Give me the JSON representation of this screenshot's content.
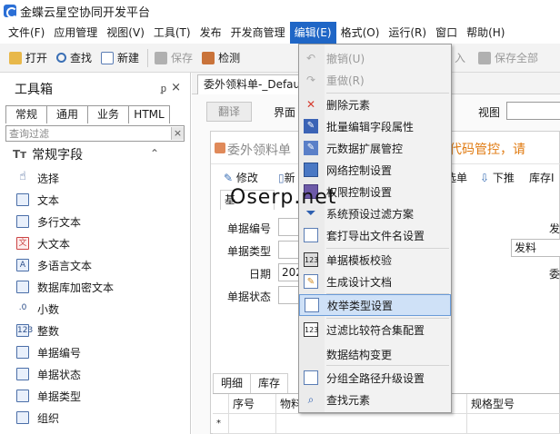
{
  "window": {
    "title": "金蝶云星空协同开发平台"
  },
  "menubar": {
    "items": [
      "文件(F)",
      "应用管理",
      "视图(V)",
      "工具(T)",
      "发布",
      "开发商管理",
      "编辑(E)",
      "格式(O)",
      "运行(R)",
      "窗口",
      "帮助(H)"
    ],
    "active": "编辑(E)"
  },
  "toolbar": {
    "items": [
      "打开",
      "查找",
      "新建",
      "保存",
      "检测"
    ],
    "right_items": [
      "入",
      "保存全部"
    ]
  },
  "toolbox": {
    "title": "工具箱",
    "tabs": [
      "常规",
      "通用",
      "业务",
      "HTML"
    ],
    "filter_placeholder": "查询过滤",
    "group": "常规字段",
    "group_prefix": "Tт",
    "items": [
      "选择",
      "文本",
      "多行文本",
      "大文本",
      "多语言文本",
      "数据库加密文本",
      "小数",
      "整数",
      "单据编号",
      "单据状态",
      "单据类型",
      "组织"
    ]
  },
  "document": {
    "tab": "委外领料单-_Defaul",
    "translate_label": "翻译",
    "face_label": "界面",
    "view_label": "视图",
    "form_title": "委外领料单",
    "orange_text": "源代码管控，请",
    "toolbar": [
      "修改",
      "新",
      "选单",
      "下推",
      "库存Ⅰ"
    ],
    "basic_tab": "基",
    "fields": [
      {
        "label": "单据编号",
        "value": ""
      },
      {
        "label": "单据类型",
        "value": ""
      },
      {
        "label": "日期",
        "value": "202"
      },
      {
        "label": "单据状态",
        "value": ""
      }
    ],
    "right_labels": [
      "发",
      "发料",
      "委"
    ],
    "bottom_tabs": [
      "明细",
      "库存"
    ],
    "grid_headers": [
      "序号",
      "物料",
      "规格型号"
    ],
    "grid_row_marker": "*"
  },
  "edit_menu": {
    "items": [
      {
        "label": "撤销(U)",
        "icon": "undo-icon",
        "disabled": true
      },
      {
        "label": "重做(R)",
        "icon": "redo-icon",
        "disabled": true
      },
      {
        "label": "删除元素",
        "icon": "delete-icon",
        "disabled": false
      },
      {
        "label": "批量编辑字段属性",
        "icon": "batch-edit-icon",
        "disabled": false
      },
      {
        "label": "元数据扩展管控",
        "icon": "metadata-icon",
        "disabled": false
      },
      {
        "label": "网络控制设置",
        "icon": "network-icon",
        "disabled": false
      },
      {
        "label": "权限控制设置",
        "icon": "permission-icon",
        "disabled": false
      },
      {
        "label": "系统预设过滤方案",
        "icon": "filter-icon",
        "disabled": false
      },
      {
        "label": "套打导出文件名设置",
        "icon": "print-icon",
        "disabled": false
      },
      {
        "label": "单据模板校验",
        "icon": "template-icon",
        "disabled": false
      },
      {
        "label": "生成设计文档",
        "icon": "document-icon",
        "disabled": false
      },
      {
        "label": "枚举类型设置",
        "icon": "enum-icon",
        "disabled": false
      },
      {
        "label": "过滤比较符合集配置",
        "icon": "compare-icon",
        "disabled": false
      },
      {
        "label": "数据结构变更",
        "icon": "",
        "disabled": false
      },
      {
        "label": "分组全路径升级设置",
        "icon": "group-icon",
        "disabled": false
      },
      {
        "label": "查找元素",
        "icon": "search-icon",
        "disabled": false
      }
    ],
    "hovered": "枚举类型设置"
  },
  "watermark": "Oserp.net",
  "colors": {
    "accent": "#1f66c6",
    "hover": "#cfe1f7",
    "orange": "#e07a10"
  }
}
